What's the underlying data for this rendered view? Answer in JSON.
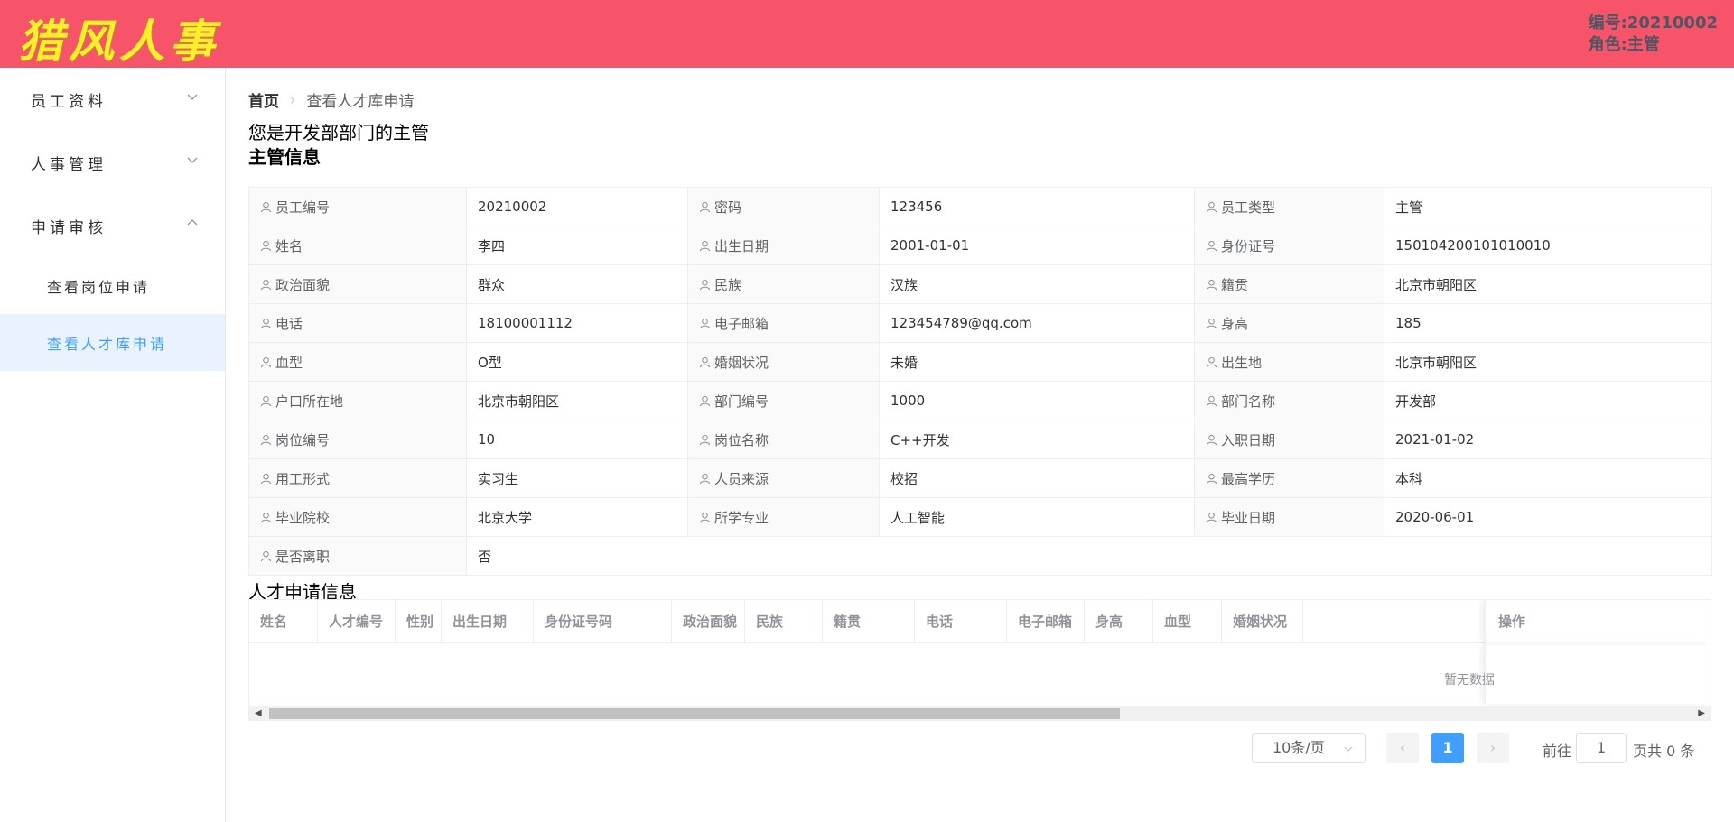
{
  "header": {
    "logo": "猎风人事",
    "user_id": "编号:20210002",
    "user_role": "角色:主管"
  },
  "sidebar": {
    "menus": [
      {
        "label": "员工资料",
        "expanded": false
      },
      {
        "label": "人事管理",
        "expanded": false
      },
      {
        "label": "申请审核",
        "expanded": true
      }
    ],
    "sub_items": [
      {
        "label": "查看岗位申请",
        "active": false
      },
      {
        "label": "查看人才库申请",
        "active": true
      }
    ]
  },
  "breadcrumb": {
    "home": "首页",
    "current": "查看人才库申请"
  },
  "intro": "您是开发部部门的主管",
  "info_title": "主管信息",
  "info_rows": [
    [
      [
        "员工编号",
        "20210002"
      ],
      [
        "密码",
        "123456"
      ],
      [
        "员工类型",
        "主管"
      ]
    ],
    [
      [
        "姓名",
        "李四"
      ],
      [
        "出生日期",
        "2001-01-01"
      ],
      [
        "身份证号",
        "150104200101010010"
      ]
    ],
    [
      [
        "政治面貌",
        "群众"
      ],
      [
        "民族",
        "汉族"
      ],
      [
        "籍贯",
        "北京市朝阳区"
      ]
    ],
    [
      [
        "电话",
        "18100001112"
      ],
      [
        "电子邮箱",
        "123454789@qq.com"
      ],
      [
        "身高",
        "185"
      ]
    ],
    [
      [
        "血型",
        "O型"
      ],
      [
        "婚姻状况",
        "未婚"
      ],
      [
        "出生地",
        "北京市朝阳区"
      ]
    ],
    [
      [
        "户口所在地",
        "北京市朝阳区"
      ],
      [
        "部门编号",
        "1000"
      ],
      [
        "部门名称",
        "开发部"
      ]
    ],
    [
      [
        "岗位编号",
        "10"
      ],
      [
        "岗位名称",
        "C++开发"
      ],
      [
        "入职日期",
        "2021-01-02"
      ]
    ],
    [
      [
        "用工形式",
        "实习生"
      ],
      [
        "人员来源",
        "校招"
      ],
      [
        "最高学历",
        "本科"
      ]
    ],
    [
      [
        "毕业院校",
        "北京大学"
      ],
      [
        "所学专业",
        "人工智能"
      ],
      [
        "毕业日期",
        "2020-06-01"
      ]
    ],
    [
      [
        "是否离职",
        "否"
      ]
    ]
  ],
  "talent": {
    "title": "人才申请信息",
    "columns": [
      "姓名",
      "人才编号",
      "性别",
      "出生日期",
      "身份证号码",
      "政治面貌",
      "民族",
      "籍贯",
      "电话",
      "电子邮箱",
      "身高",
      "血型",
      "婚姻状况"
    ],
    "op_column": "操作",
    "empty_text": "暂无数据"
  },
  "pagination": {
    "page_size": "10条/页",
    "current_page": "1",
    "goto_label": "前往",
    "goto_value": "1",
    "total_label": "页共 0 条"
  },
  "colors": {
    "header": "#f75369",
    "logo": "#ffef2a",
    "accent": "#409eff"
  }
}
